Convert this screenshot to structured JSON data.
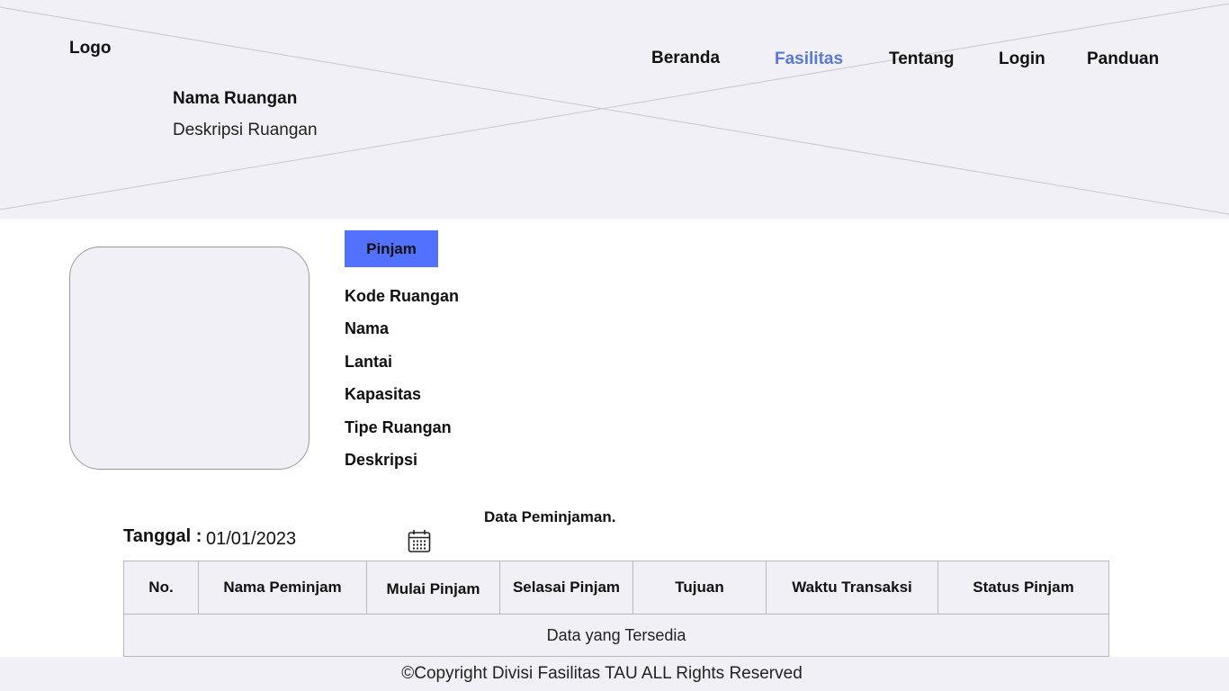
{
  "header": {
    "logo": "Logo",
    "nav": [
      {
        "label": "Beranda",
        "active": false
      },
      {
        "label": "Fasilitas",
        "active": true
      },
      {
        "label": "Tentang",
        "active": false
      },
      {
        "label": "Login",
        "active": false
      },
      {
        "label": "Panduan",
        "active": false
      }
    ],
    "title": "Nama Ruangan",
    "description": "Deskripsi Ruangan"
  },
  "room": {
    "button_label": "Pinjam",
    "fields": [
      "Kode Ruangan",
      "Nama",
      "Lantai",
      "Kapasitas",
      "Tipe Ruangan",
      "Deskripsi"
    ]
  },
  "filter": {
    "label": "Tanggal :",
    "date_value": "01/01/2023",
    "icon": "calendar-icon"
  },
  "table": {
    "title": "Data Peminjaman.",
    "columns": [
      "No.",
      "Nama Peminjam",
      "Mulai Pinjam",
      "Selasai Pinjam",
      "Tujuan",
      "Waktu Transaksi",
      "Status Pinjam"
    ],
    "empty_text": "Data yang Tersedia"
  },
  "footer": {
    "copyright": "©Copyright Divisi Fasilitas TAU ALL Rights Reserved"
  },
  "colors": {
    "primary_button": "#5271ff",
    "active_nav": "#5a78d8",
    "panel_bg": "#f1f0f6"
  }
}
